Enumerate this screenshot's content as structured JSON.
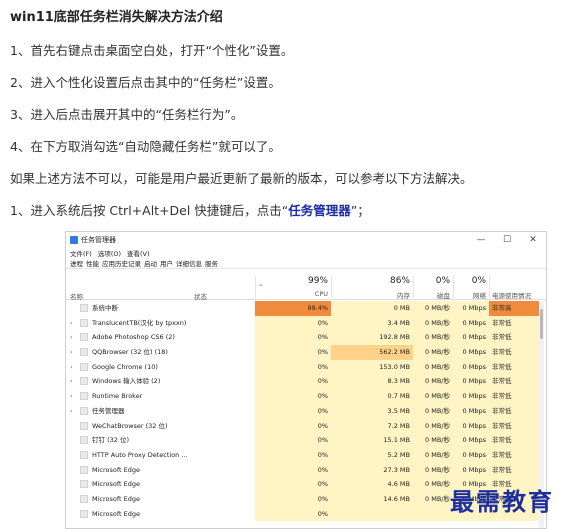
{
  "title": "win11底部任务栏消失解决方法介绍",
  "steps": [
    "1、首先右键点击桌面空白处，打开“个性化”设置。",
    "2、进入个性化设置后点击其中的“任务栏”设置。",
    "3、进入后点击展开其中的“任务栏行为”。",
    "4、在下方取消勾选“自动隐藏任务栏”就可以了。",
    "如果上述方法不可以，可能是用户最近更新了最新的版本，可以参考以下方法解决。"
  ],
  "last_step": {
    "prefix": "1、进入系统后按 Ctrl+Alt+Del 快捷键后，点击“",
    "highlight": "任务管理器",
    "suffix": "”；"
  },
  "task_manager": {
    "title": "任务管理器",
    "window_buttons": [
      "—",
      "☐",
      "✕"
    ],
    "menu": [
      "文件(F)",
      "选项(O)",
      "查看(V)"
    ],
    "tabs": [
      "进程",
      "性能",
      "应用历史记录",
      "启动",
      "用户",
      "详细信息",
      "服务"
    ],
    "columns": {
      "name": "名称",
      "status": "状态",
      "cpu": {
        "pct": "99%",
        "label": "CPU"
      },
      "memory": {
        "pct": "86%",
        "label": "内存"
      },
      "disk": {
        "pct": "0%",
        "label": "磁盘"
      },
      "network": {
        "pct": "0%",
        "label": "网络"
      },
      "power": {
        "label": "电源使用情况"
      }
    },
    "rows": [
      {
        "name": "系统中断",
        "expand": "",
        "cpu": "99.4%",
        "mem": "0 MB",
        "disk": "0 MB/秒",
        "net": "0 Mbps",
        "power": "非常高"
      },
      {
        "name": "TranslucentTB(汉化 by tpxxn)",
        "expand": "›",
        "cpu": "0%",
        "mem": "3.4 MB",
        "disk": "0 MB/秒",
        "net": "0 Mbps",
        "power": "非常低"
      },
      {
        "name": "Adobe Photoshop CS6 (2)",
        "expand": "›",
        "cpu": "0%",
        "mem": "192.8 MB",
        "disk": "0 MB/秒",
        "net": "0 Mbps",
        "power": "非常低"
      },
      {
        "name": "QQBrowser (32 位) (18)",
        "expand": "›",
        "cpu": "0%",
        "mem": "562.2 MB",
        "disk": "0 MB/秒",
        "net": "0 Mbps",
        "power": "非常低"
      },
      {
        "name": "Google Chrome (10)",
        "expand": "›",
        "cpu": "0%",
        "mem": "153.0 MB",
        "disk": "0 MB/秒",
        "net": "0 Mbps",
        "power": "非常低"
      },
      {
        "name": "Windows 输入体验 (2)",
        "expand": "›",
        "cpu": "0%",
        "mem": "8.3 MB",
        "disk": "0 MB/秒",
        "net": "0 Mbps",
        "power": "非常低"
      },
      {
        "name": "Runtime Broker",
        "expand": "›",
        "cpu": "0%",
        "mem": "0.7 MB",
        "disk": "0 MB/秒",
        "net": "0 Mbps",
        "power": "非常低"
      },
      {
        "name": "任务管理器",
        "expand": "›",
        "cpu": "0%",
        "mem": "3.5 MB",
        "disk": "0 MB/秒",
        "net": "0 Mbps",
        "power": "非常低"
      },
      {
        "name": "WeChatBrowser (32 位)",
        "expand": "",
        "cpu": "0%",
        "mem": "7.2 MB",
        "disk": "0 MB/秒",
        "net": "0 Mbps",
        "power": "非常低"
      },
      {
        "name": "钉钉 (32 位)",
        "expand": "",
        "cpu": "0%",
        "mem": "15.1 MB",
        "disk": "0 MB/秒",
        "net": "0 Mbps",
        "power": "非常低"
      },
      {
        "name": "HTTP Auto Proxy Detection ...",
        "expand": "",
        "cpu": "0%",
        "mem": "5.2 MB",
        "disk": "0 MB/秒",
        "net": "0 Mbps",
        "power": "非常低"
      },
      {
        "name": "Microsoft Edge",
        "expand": "",
        "cpu": "0%",
        "mem": "27.3 MB",
        "disk": "0 MB/秒",
        "net": "0 Mbps",
        "power": "非常低"
      },
      {
        "name": "Microsoft Edge",
        "expand": "",
        "cpu": "0%",
        "mem": "4.6 MB",
        "disk": "0 MB/秒",
        "net": "0 Mbps",
        "power": "非常低"
      },
      {
        "name": "Microsoft Edge",
        "expand": "",
        "cpu": "0%",
        "mem": "14.6 MB",
        "disk": "0 MB/秒",
        "net": "0 Mbps",
        "power": "非常低"
      },
      {
        "name": "Microsoft Edge",
        "expand": "",
        "cpu": "0%",
        "mem": "",
        "disk": "",
        "net": "",
        "power": ""
      }
    ]
  },
  "watermark": "最需教育"
}
